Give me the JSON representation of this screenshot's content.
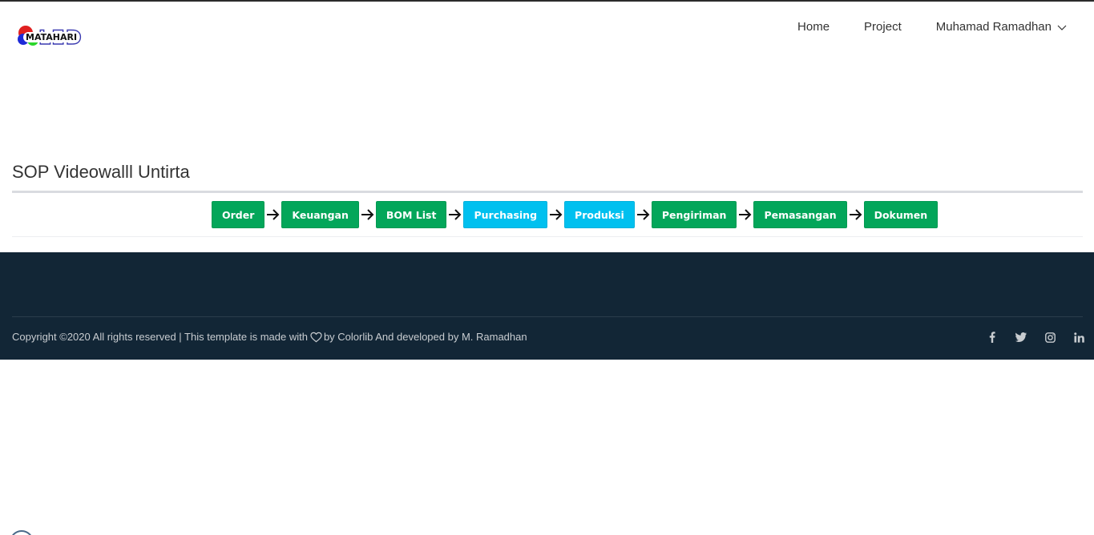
{
  "header": {
    "logo": {
      "brand": "MATAHARI",
      "led": "LED"
    },
    "nav": [
      {
        "label": "Home"
      },
      {
        "label": "Project"
      },
      {
        "label": "Muhamad Ramadhan",
        "icon": "chevron-down-icon"
      }
    ]
  },
  "main": {
    "title": "SOP Videowalll Untirta",
    "steps": [
      {
        "label": "Order",
        "status": "done",
        "color": "#03a65a"
      },
      {
        "label": "Keuangan",
        "status": "done",
        "color": "#03a65a"
      },
      {
        "label": "BOM List",
        "status": "done",
        "color": "#03a65a"
      },
      {
        "label": "Purchasing",
        "status": "active",
        "color": "#00c0ef"
      },
      {
        "label": "Produksi",
        "status": "active",
        "color": "#00c0ef"
      },
      {
        "label": "Pengiriman",
        "status": "done",
        "color": "#03a65a"
      },
      {
        "label": "Pemasangan",
        "status": "done",
        "color": "#03a65a"
      },
      {
        "label": "Dokumen",
        "status": "done",
        "color": "#03a65a"
      }
    ]
  },
  "footer": {
    "copyright_before": "Copyright ©2020 All rights reserved | This template is made with",
    "copyright_after": "by Colorlib And developed by M. Ramadhan",
    "social": [
      "facebook-icon",
      "twitter-icon",
      "instagram-icon",
      "linkedin-icon"
    ]
  },
  "colors": {
    "footer_bg": "#122636",
    "done": "#03a65a",
    "active": "#00c0ef"
  }
}
